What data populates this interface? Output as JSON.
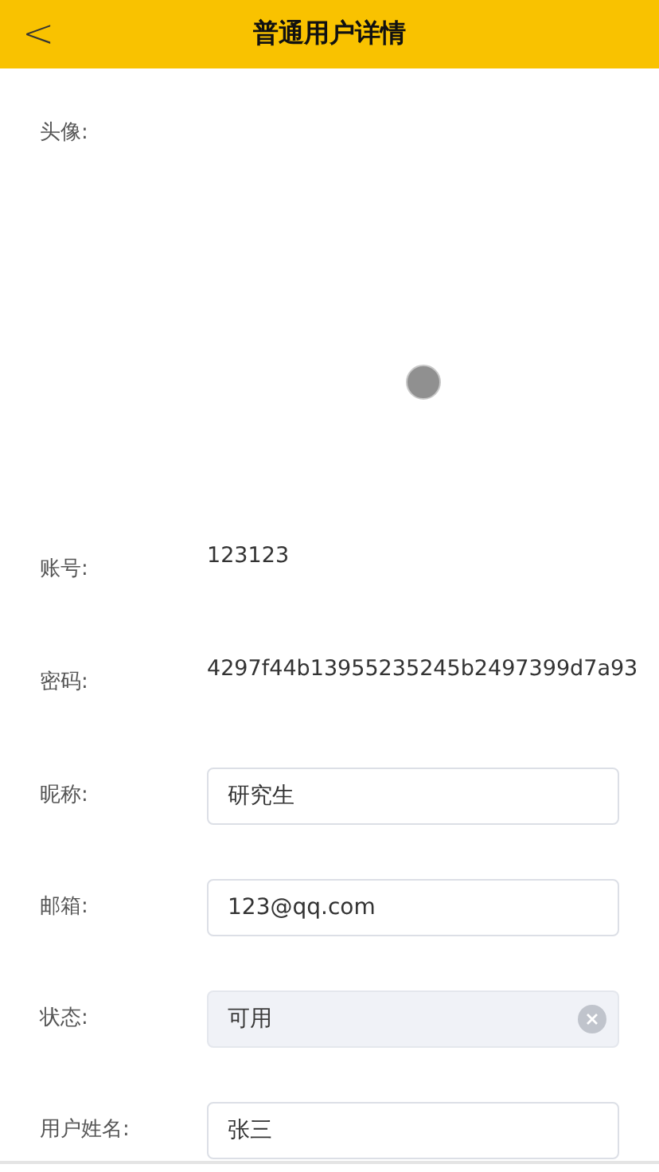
{
  "header": {
    "back": "<",
    "title": "普通用户详情"
  },
  "rows": [
    {
      "kind": "avatar",
      "label": "头像:"
    },
    {
      "kind": "text",
      "label": "账号:",
      "value": "123123"
    },
    {
      "kind": "text",
      "label": "密码:",
      "value": "4297f44b13955235245b2497399d7a93"
    },
    {
      "kind": "input",
      "label": "昵称:",
      "value": "研究生",
      "disabled": false,
      "clearable": false
    },
    {
      "kind": "input",
      "label": "邮箱:",
      "value": "123@qq.com",
      "disabled": false,
      "clearable": false
    },
    {
      "kind": "input",
      "label": "状态:",
      "value": "可用",
      "disabled": true,
      "clearable": true
    },
    {
      "kind": "input",
      "label": "用户姓名:",
      "value": "张三",
      "disabled": false,
      "clearable": false
    }
  ]
}
